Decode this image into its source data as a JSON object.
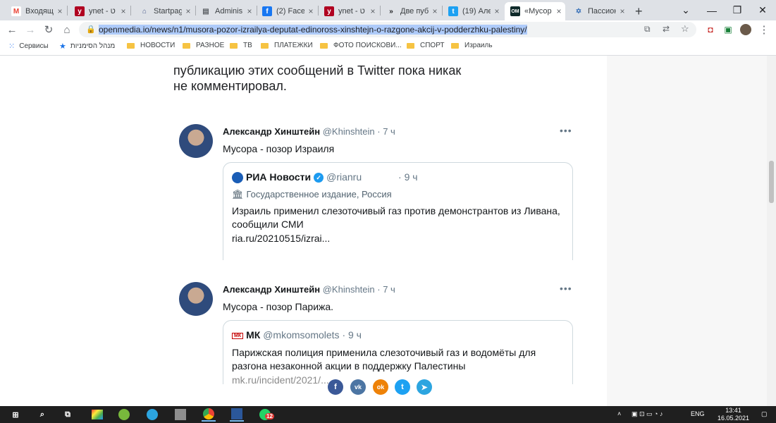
{
  "browser": {
    "tabs": [
      {
        "label": "Входящи",
        "icon": "gmail-icon",
        "fav": "M",
        "fav_color": "#ea4335",
        "fav_bg": "#ffffff"
      },
      {
        "label": "ynet - ט",
        "icon": "ynet-icon",
        "fav": "y",
        "fav_color": "#ffffff",
        "fav_bg": "#b00020"
      },
      {
        "label": "Startpag",
        "icon": "startpage-icon",
        "fav": "⌂",
        "fav_color": "#4a5a8a",
        "fav_bg": "transparent"
      },
      {
        "label": "Adminis",
        "icon": "document-icon",
        "fav": "▤",
        "fav_color": "#5f6368",
        "fav_bg": "transparent"
      },
      {
        "label": "(2) Faceb",
        "icon": "facebook-icon",
        "fav": "f",
        "fav_color": "#ffffff",
        "fav_bg": "#1877f2"
      },
      {
        "label": "ynet - ט",
        "icon": "ynet-icon",
        "fav": "y",
        "fav_color": "#ffffff",
        "fav_bg": "#b00020"
      },
      {
        "label": "Две пуб",
        "icon": "site-icon",
        "fav": "»",
        "fav_color": "#202124",
        "fav_bg": "transparent"
      },
      {
        "label": "(19) Але",
        "icon": "twitter-icon",
        "fav": "t",
        "fav_color": "#ffffff",
        "fav_bg": "#1da1f2"
      },
      {
        "label": "«Мусор",
        "icon": "openmedia-icon",
        "fav": "OM",
        "fav_color": "#ffffff",
        "fav_bg": "#0f2a2a",
        "active": true
      },
      {
        "label": "Пассион",
        "icon": "star-of-david-icon",
        "fav": "✡",
        "fav_color": "#3b73b9",
        "fav_bg": "transparent"
      }
    ],
    "new_tab": "+",
    "url_prefix": "",
    "url": "openmedia.io/news/n1/musora-pozor-izrailya-deputat-edinoross-xinshtejn-o-razgone-akcij-v-podderzhku-palestiny/"
  },
  "bookmarks": [
    {
      "label": "Сервисы",
      "icon": "apps-icon"
    },
    {
      "label": "מנהל הסימניות",
      "icon": "star-icon"
    },
    {
      "label": "НОВОСТИ",
      "icon": "folder-icon"
    },
    {
      "label": "РАЗНОЕ",
      "icon": "folder-icon"
    },
    {
      "label": "ТВ",
      "icon": "folder-icon"
    },
    {
      "label": "ПЛАТЕЖКИ",
      "icon": "folder-icon"
    },
    {
      "label": "ФОТО ПОИСКОВИ...",
      "icon": "folder-icon"
    },
    {
      "label": "СПОРТ",
      "icon": "folder-icon"
    },
    {
      "label": "Израиль",
      "icon": "folder-icon"
    }
  ],
  "article": {
    "line1": "публикацию этих сообщений в Twitter пока никак",
    "line2": "не комментировал."
  },
  "tweets": [
    {
      "name": "Александр Хинштейн",
      "handle": "@Khinshtein · 7 ч",
      "text": "Мусора - позор Израиля",
      "quote": {
        "name": "РИА Новости",
        "handle": "@rianru",
        "time": "· 9 ч",
        "label": "Государственное издание, Россия",
        "text": "Израиль применил слезоточивый газ против демонстрантов из Ливана, сообщили СМИ",
        "link": "ria.ru/20210515/izrai..."
      }
    },
    {
      "name": "Александр Хинштейн",
      "handle": "@Khinshtein · 7 ч",
      "text": "Мусора - позор Парижа.",
      "quote": {
        "name": "МК",
        "handle": "@mkomsomolets · 9 ч",
        "logo": "МК",
        "text": "Парижская полиция применила слезоточивый газ и водомёты для разгона незаконной акции в поддержку Палестины",
        "link": "mk.ru/incident/2021/..."
      }
    }
  ],
  "share": [
    {
      "label": "f",
      "icon": "facebook-share-icon",
      "color": "#3b5998"
    },
    {
      "label": "vk",
      "icon": "vk-share-icon",
      "color": "#4c75a3"
    },
    {
      "label": "ok",
      "icon": "odnoklassniki-share-icon",
      "color": "#ee8208"
    },
    {
      "label": "t",
      "icon": "twitter-share-icon",
      "color": "#1da1f2"
    },
    {
      "label": "➤",
      "icon": "telegram-share-icon",
      "color": "#2ca5e0"
    }
  ],
  "taskbar": {
    "language": "ENG",
    "time": "13:41",
    "date": "16.05.2021",
    "whatsapp_badge": "12"
  }
}
